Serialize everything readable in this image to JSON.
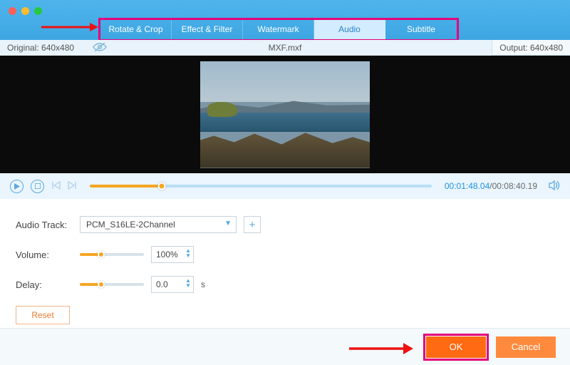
{
  "tabs": {
    "t0": "Rotate & Crop",
    "t1": "Effect & Filter",
    "t2": "Watermark",
    "t3": "Audio",
    "t4": "Subtitle"
  },
  "dimensions": {
    "original_label": "Original: 640x480",
    "filename": "MXF.mxf",
    "output_label": "Output: 640x480"
  },
  "playback": {
    "current": "00:01:48.04",
    "sep": "/",
    "total": "00:08:40.19"
  },
  "settings": {
    "audio_track_label": "Audio Track:",
    "audio_track_value": "PCM_S16LE-2Channel",
    "volume_label": "Volume:",
    "volume_value": "100%",
    "delay_label": "Delay:",
    "delay_value": "0.0",
    "delay_unit": "s",
    "reset": "Reset"
  },
  "footer": {
    "ok": "OK",
    "cancel": "Cancel"
  },
  "colors": {
    "accent": "#4fa6e0",
    "orange": "#f5a623",
    "magenta": "#e3007b"
  }
}
